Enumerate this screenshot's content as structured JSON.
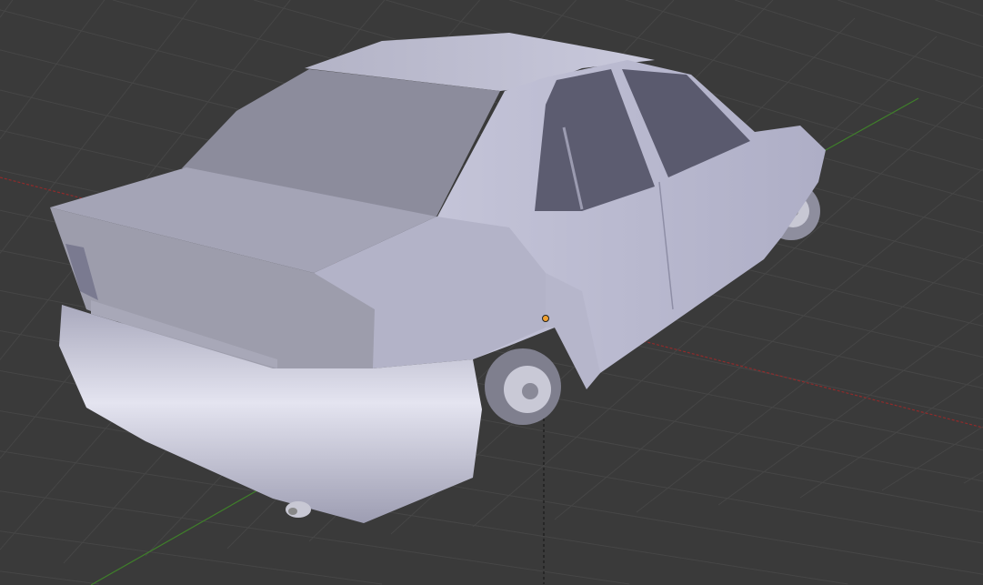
{
  "viewport": {
    "background": "#3a3a3a",
    "grid_color": "#474747",
    "x_axis_color": "#8f2b2b",
    "y_axis_color": "#3f7f2a",
    "object_color": "#b9b9cf",
    "origin_color": "#f0a030"
  }
}
